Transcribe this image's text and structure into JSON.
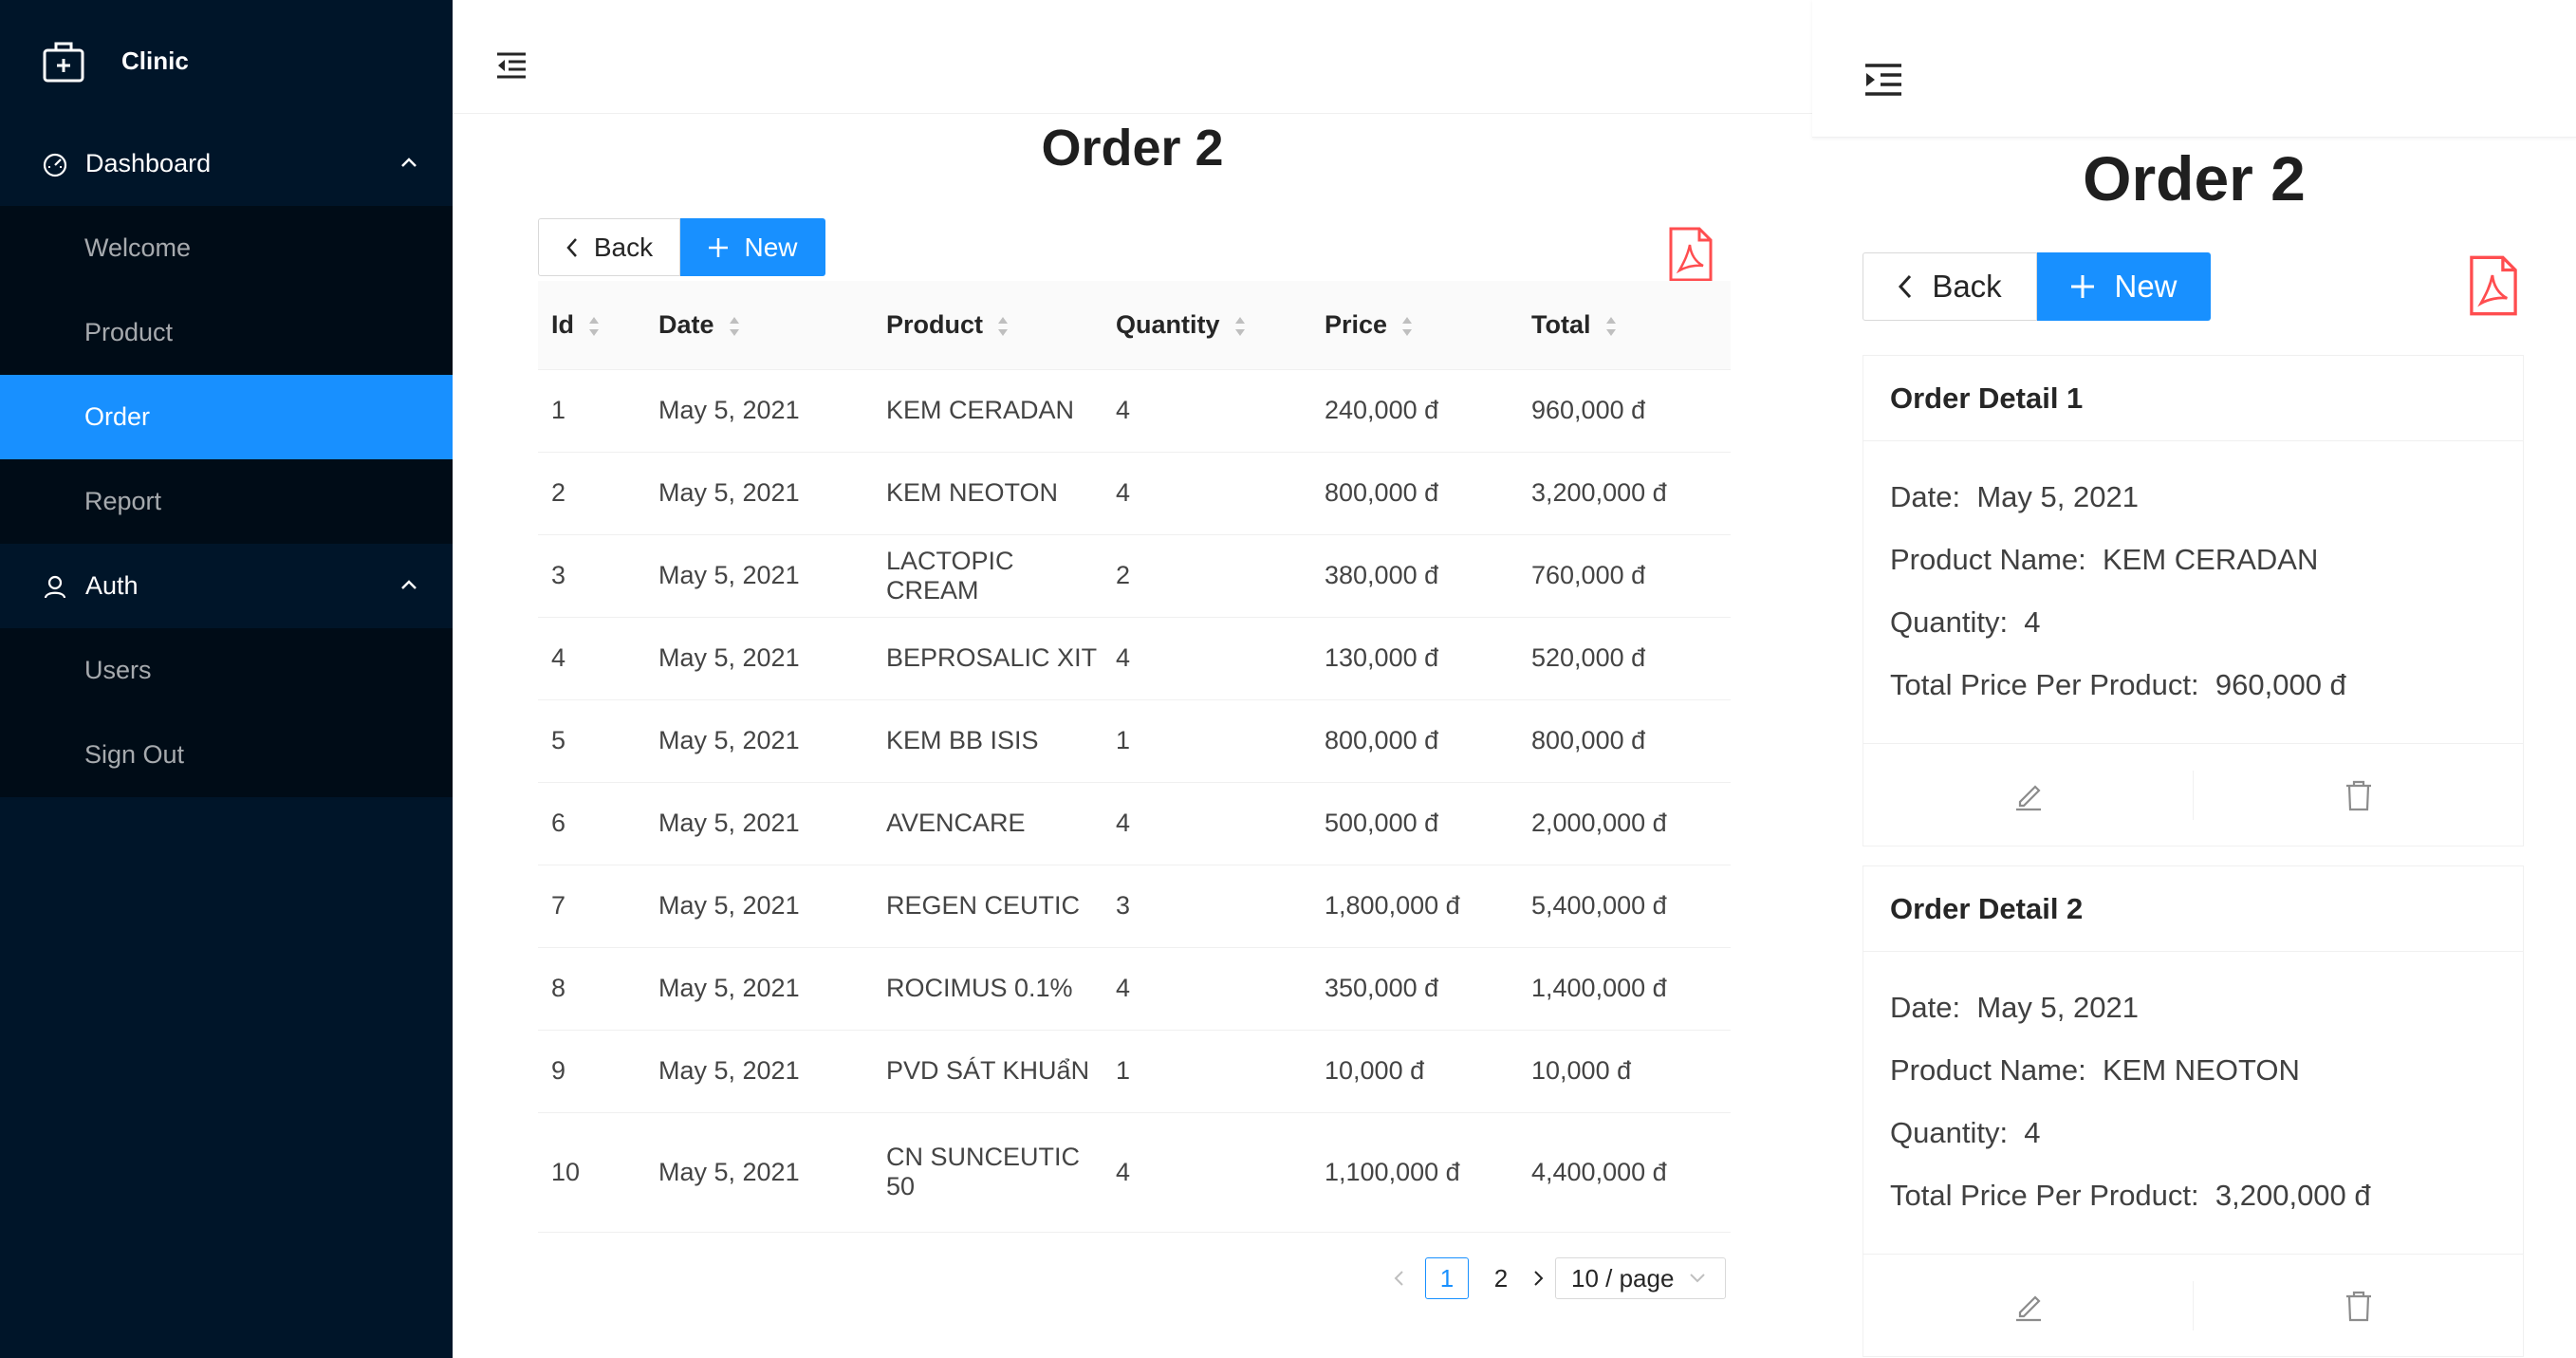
{
  "app": {
    "name": "Clinic"
  },
  "sidebar": {
    "groups": [
      {
        "label": "Dashboard",
        "icon": "dashboard-icon",
        "items": [
          {
            "label": "Welcome"
          },
          {
            "label": "Product"
          },
          {
            "label": "Order",
            "active": true
          },
          {
            "label": "Report"
          }
        ]
      },
      {
        "label": "Auth",
        "icon": "user-icon",
        "items": [
          {
            "label": "Users"
          },
          {
            "label": "Sign Out"
          }
        ]
      }
    ]
  },
  "main": {
    "title": "Order 2",
    "back_label": "Back",
    "new_label": "New",
    "table": {
      "columns": [
        "Id",
        "Date",
        "Product",
        "Quantity",
        "Price",
        "Total"
      ],
      "rows": [
        [
          "1",
          "May 5, 2021",
          "KEM CERADAN",
          "4",
          "240,000 đ",
          "960,000 đ"
        ],
        [
          "2",
          "May 5, 2021",
          "KEM NEOTON",
          "4",
          "800,000 đ",
          "3,200,000 đ"
        ],
        [
          "3",
          "May 5, 2021",
          "LACTOPIC CREAM",
          "2",
          "380,000 đ",
          "760,000 đ"
        ],
        [
          "4",
          "May 5, 2021",
          "BEPROSALIC XIT",
          "4",
          "130,000 đ",
          "520,000 đ"
        ],
        [
          "5",
          "May 5, 2021",
          "KEM BB ISIS",
          "1",
          "800,000 đ",
          "800,000 đ"
        ],
        [
          "6",
          "May 5, 2021",
          "AVENCARE",
          "4",
          "500,000 đ",
          "2,000,000 đ"
        ],
        [
          "7",
          "May 5, 2021",
          "REGEN CEUTIC",
          "3",
          "1,800,000 đ",
          "5,400,000 đ"
        ],
        [
          "8",
          "May 5, 2021",
          "ROCIMUS 0.1%",
          "4",
          "350,000 đ",
          "1,400,000 đ"
        ],
        [
          "9",
          "May 5, 2021",
          "PVD SÁT KHUẩN",
          "1",
          "10,000 đ",
          "10,000 đ"
        ],
        [
          "10",
          "May 5, 2021",
          "CN SUNCEUTIC 50",
          "4",
          "1,100,000 đ",
          "4,400,000 đ"
        ]
      ]
    },
    "pagination": {
      "pages": [
        "1",
        "2"
      ],
      "current": "1",
      "page_size": "10 / page"
    }
  },
  "mobile": {
    "title": "Order 2",
    "back_label": "Back",
    "new_label": "New",
    "cards": [
      {
        "title": "Order Detail 1",
        "fields": [
          {
            "label": "Date",
            "value": "May 5, 2021"
          },
          {
            "label": "Product Name",
            "value": "KEM CERADAN"
          },
          {
            "label": "Quantity",
            "value": "4"
          },
          {
            "label": "Total Price Per Product",
            "value": "960,000 đ"
          }
        ]
      },
      {
        "title": "Order Detail 2",
        "fields": [
          {
            "label": "Date",
            "value": "May 5, 2021"
          },
          {
            "label": "Product Name",
            "value": "KEM NEOTON"
          },
          {
            "label": "Quantity",
            "value": "4"
          },
          {
            "label": "Total Price Per Product",
            "value": "3,200,000 đ"
          }
        ]
      }
    ]
  },
  "colors": {
    "primary": "#1890ff",
    "sider_bg": "#001529",
    "submenu_bg": "#000c17",
    "pdf": "#ff4d4f"
  }
}
